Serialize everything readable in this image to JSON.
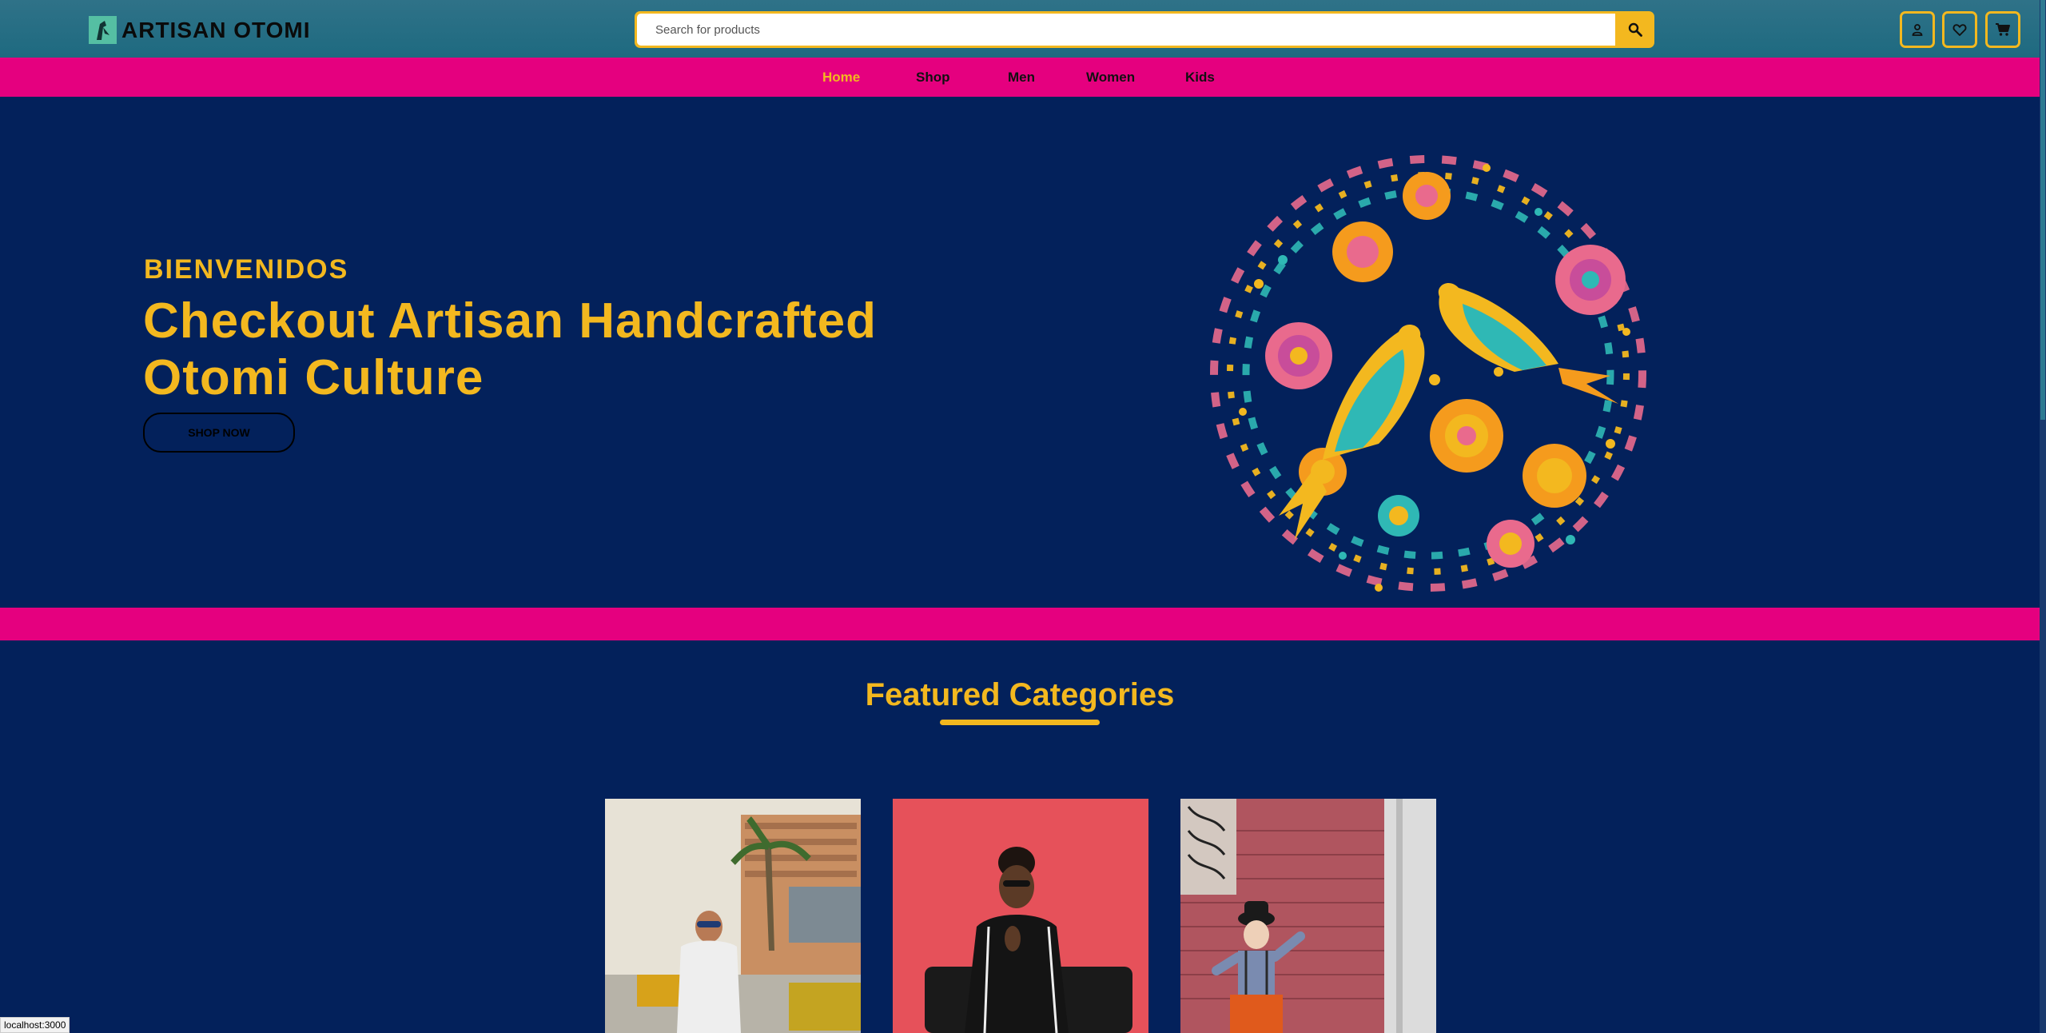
{
  "header": {
    "brand": "ARTISAN OTOMI",
    "search_placeholder": "Search for products",
    "icons": [
      "user-icon",
      "heart-icon",
      "cart-icon",
      "search-icon"
    ]
  },
  "nav": {
    "items": [
      {
        "label": "Home",
        "active": true
      },
      {
        "label": "Shop"
      },
      {
        "label": "Men"
      },
      {
        "label": "Women"
      },
      {
        "label": "Kids"
      }
    ]
  },
  "hero": {
    "subtitle": "BIENVENIDOS",
    "title": "Checkout Artisan Handcrafted Otomi Culture",
    "cta_label": "SHOP NOW"
  },
  "featured": {
    "title": "Featured Categories"
  },
  "status_bar": {
    "url": "localhost:3000"
  },
  "colors": {
    "background": "#03215b",
    "accent": "#f3b81f",
    "magenta": "#e5007f",
    "header": "#1e6a80"
  }
}
